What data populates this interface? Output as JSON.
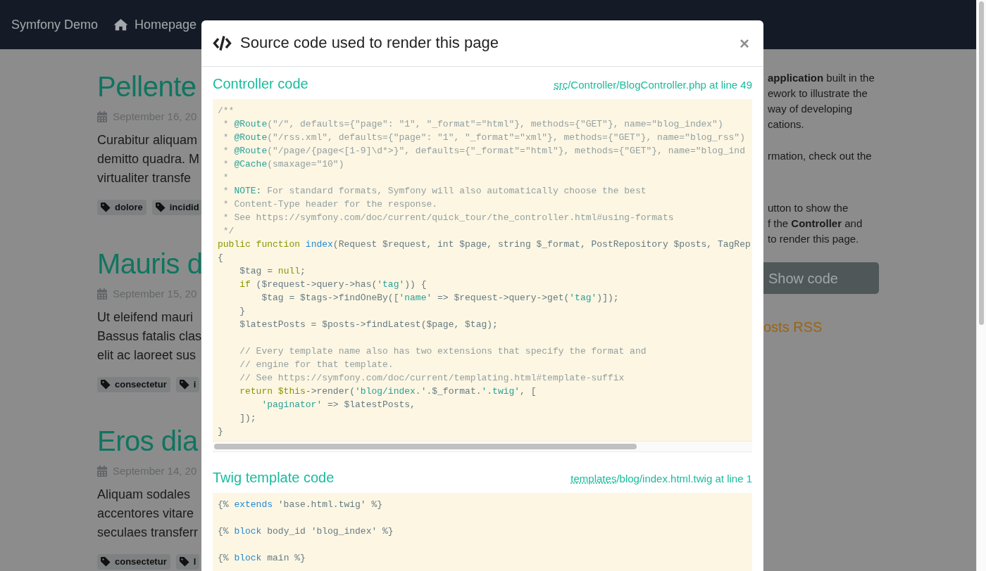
{
  "navbar": {
    "brand": "Symfony Demo",
    "links": [
      {
        "label": "Homepage"
      }
    ]
  },
  "posts": [
    {
      "title": "Pellente",
      "date": "September 16, 20",
      "summary": [
        "Curabitur aliquam",
        "demitto quadra. M",
        "virtualiter transfe"
      ],
      "tags": [
        "dolore",
        "incidid"
      ]
    },
    {
      "title": "Mauris d",
      "date": "September 15, 20",
      "summary": [
        "Ut eleifend mauri",
        "Bassus fatalis clas",
        "elit ac laoreet sus"
      ],
      "tags": [
        "consectetur",
        "i"
      ]
    },
    {
      "title": "Eros dia",
      "date": "September 14, 20",
      "summary": [
        "Aliquam sodales",
        "accentores vitare",
        "seculaes transferr"
      ],
      "tags": [
        "consectetur",
        "l"
      ]
    }
  ],
  "sidebar": {
    "paragraphs": [
      [
        "**application** built in the",
        "ework to illustrate the",
        "way of developing",
        "cations."
      ],
      [
        "rmation, check out the"
      ],
      [
        "utton to show the",
        "f the **Controller** and",
        "to render this page."
      ]
    ],
    "button": "Show code",
    "rss_link": "osts RSS"
  },
  "modal": {
    "title": "Source code used to render this page",
    "close": "×",
    "sections": [
      {
        "heading": "Controller code",
        "file_link": {
          "abbr": "src",
          "text": "/Controller/BlogController.php at line 49"
        },
        "scrollbar": true,
        "code_groups": [
          [
            [
              {
                "kind": "comment",
                "text": "/**"
              }
            ],
            [
              {
                "kind": "comment",
                "text": " * "
              },
              {
                "kind": "annotation",
                "text": "@Route"
              },
              {
                "kind": "comment",
                "text": "(\"/\", defaults={\"page\": \"1\", \"_format\"=\"html\"}, methods={\"GET\"}, name=\"blog_index\")"
              }
            ],
            [
              {
                "kind": "comment",
                "text": " * "
              },
              {
                "kind": "annotation",
                "text": "@Route"
              },
              {
                "kind": "comment",
                "text": "(\"/rss.xml\", defaults={\"page\": \"1\", \"_format\"=\"xml\"}, methods={\"GET\"}, name=\"blog_rss\")"
              }
            ],
            [
              {
                "kind": "comment",
                "text": " * "
              },
              {
                "kind": "annotation",
                "text": "@Route"
              },
              {
                "kind": "comment",
                "text": "(\"/page/{page<[1-9]\\d*>}\", defaults={\"_format\"=\"html\"}, methods={\"GET\"}, name=\"blog_ind"
              }
            ],
            [
              {
                "kind": "comment",
                "text": " * "
              },
              {
                "kind": "annotation",
                "text": "@Cache"
              },
              {
                "kind": "comment",
                "text": "(smaxage=\"10\")"
              }
            ],
            [
              {
                "kind": "comment",
                "text": " *"
              }
            ],
            [
              {
                "kind": "comment",
                "text": " * "
              },
              {
                "kind": "annotation",
                "text": "NOTE:"
              },
              {
                "kind": "comment",
                "text": " For standard formats, Symfony will also automatically choose the best"
              }
            ],
            [
              {
                "kind": "comment",
                "text": " * Content-Type header for the response."
              }
            ],
            [
              {
                "kind": "comment",
                "text": " * See https://symfony.com/doc/current/quick_tour/the_controller.html#using-formats"
              }
            ],
            [
              {
                "kind": "comment",
                "text": " */"
              }
            ],
            [
              {
                "kind": "keyword",
                "text": "public function "
              },
              {
                "kind": "entity",
                "text": "index"
              },
              {
                "kind": "plain",
                "text": "(Request $request, int $page, string $_format, PostRepository $posts, TagRep"
              }
            ],
            [
              {
                "kind": "plain",
                "text": "{"
              }
            ],
            [
              {
                "kind": "plain",
                "text": "    $tag = "
              },
              {
                "kind": "keyword",
                "text": "null"
              },
              {
                "kind": "plain",
                "text": ";"
              }
            ],
            [
              {
                "kind": "keyword",
                "text": "    if"
              },
              {
                "kind": "plain",
                "text": " ($request->query->has("
              },
              {
                "kind": "string",
                "text": "'tag'"
              },
              {
                "kind": "plain",
                "text": ")) {"
              }
            ],
            [
              {
                "kind": "plain",
                "text": "        $tag = $tags->findOneBy(["
              },
              {
                "kind": "string",
                "text": "'name'"
              },
              {
                "kind": "plain",
                "text": " => $request->query->get("
              },
              {
                "kind": "string",
                "text": "'tag'"
              },
              {
                "kind": "plain",
                "text": ")]);"
              }
            ],
            [
              {
                "kind": "plain",
                "text": "    }"
              }
            ],
            [
              {
                "kind": "plain",
                "text": "    $latestPosts = $posts->findLatest($page, $tag);"
              }
            ]
          ],
          [
            [
              {
                "kind": "comment",
                "text": "    // Every template name also has two extensions that specify the format and"
              }
            ],
            [
              {
                "kind": "comment",
                "text": "    // engine for that template."
              }
            ],
            [
              {
                "kind": "comment",
                "text": "    // See https://symfony.com/doc/current/templating.html#template-suffix"
              }
            ],
            [
              {
                "kind": "keyword",
                "text": "    return $this"
              },
              {
                "kind": "plain",
                "text": "->render("
              },
              {
                "kind": "string",
                "text": "'blog/index.'"
              },
              {
                "kind": "plain",
                "text": ".$_format."
              },
              {
                "kind": "string",
                "text": "'.twig'"
              },
              {
                "kind": "plain",
                "text": ", ["
              }
            ],
            [
              {
                "kind": "string",
                "text": "        'paginator'"
              },
              {
                "kind": "plain",
                "text": " => $latestPosts,"
              }
            ],
            [
              {
                "kind": "plain",
                "text": "    ]);"
              }
            ],
            [
              {
                "kind": "plain",
                "text": "}"
              }
            ]
          ]
        ]
      },
      {
        "heading": "Twig template code",
        "file_link": {
          "abbr": "templates",
          "text": "/blog/index.html.twig at line 1"
        },
        "scrollbar": false,
        "code_groups": [
          [
            [
              {
                "kind": "plain",
                "text": "{% "
              },
              {
                "kind": "entity",
                "text": "extends"
              },
              {
                "kind": "plain",
                "text": " 'base.html.twig' %}"
              }
            ]
          ],
          [
            [
              {
                "kind": "plain",
                "text": "{% "
              },
              {
                "kind": "entity",
                "text": "block"
              },
              {
                "kind": "plain",
                "text": " body_id 'blog_index' %}"
              }
            ]
          ],
          [
            [
              {
                "kind": "plain",
                "text": "{% "
              },
              {
                "kind": "entity",
                "text": "block"
              },
              {
                "kind": "plain",
                "text": " main %}"
              }
            ]
          ]
        ]
      }
    ]
  }
}
